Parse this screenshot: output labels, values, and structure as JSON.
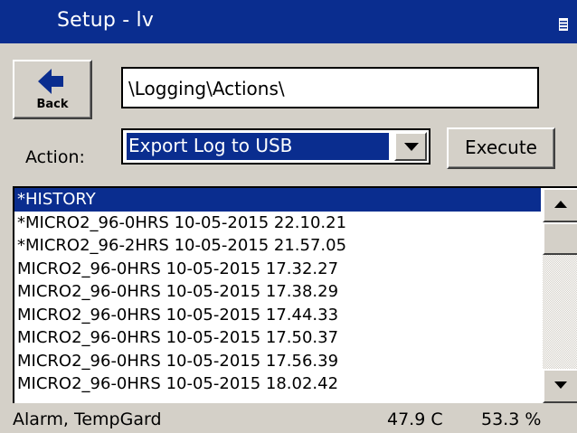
{
  "window": {
    "title": "Setup - lv"
  },
  "toolbar": {
    "back_label": "Back"
  },
  "path": {
    "value": "\\Logging\\Actions\\"
  },
  "action": {
    "label": "Action:",
    "selected": "Export Log to USB",
    "execute_label": "Execute"
  },
  "logs": {
    "items": [
      {
        "label": "*HISTORY",
        "selected": true
      },
      {
        "label": "*MICRO2_96-0HRS 10-05-2015 22.10.21",
        "selected": false
      },
      {
        "label": "*MICRO2_96-2HRS 10-05-2015 21.57.05",
        "selected": false
      },
      {
        "label": "MICRO2_96-0HRS 10-05-2015 17.32.27",
        "selected": false
      },
      {
        "label": "MICRO2_96-0HRS 10-05-2015 17.38.29",
        "selected": false
      },
      {
        "label": "MICRO2_96-0HRS 10-05-2015 17.44.33",
        "selected": false
      },
      {
        "label": "MICRO2_96-0HRS 10-05-2015 17.50.37",
        "selected": false
      },
      {
        "label": "MICRO2_96-0HRS 10-05-2015 17.56.39",
        "selected": false
      },
      {
        "label": "MICRO2_96-0HRS 10-05-2015 18.02.42",
        "selected": false
      }
    ]
  },
  "status": {
    "text": "Alarm, TempGard",
    "temperature": "47.9 C",
    "humidity": "53.3 %"
  },
  "icons": {
    "menu": "menu-icon",
    "back": "back-arrow-icon",
    "dropdown": "chevron-down-icon",
    "scroll_up": "scroll-up-icon",
    "scroll_down": "scroll-down-icon"
  },
  "colors": {
    "titlebar": "#0a2d8f",
    "selection": "#0a2d8f",
    "chrome": "#d4d0c8",
    "back_arrow": "#0a2d8f"
  }
}
